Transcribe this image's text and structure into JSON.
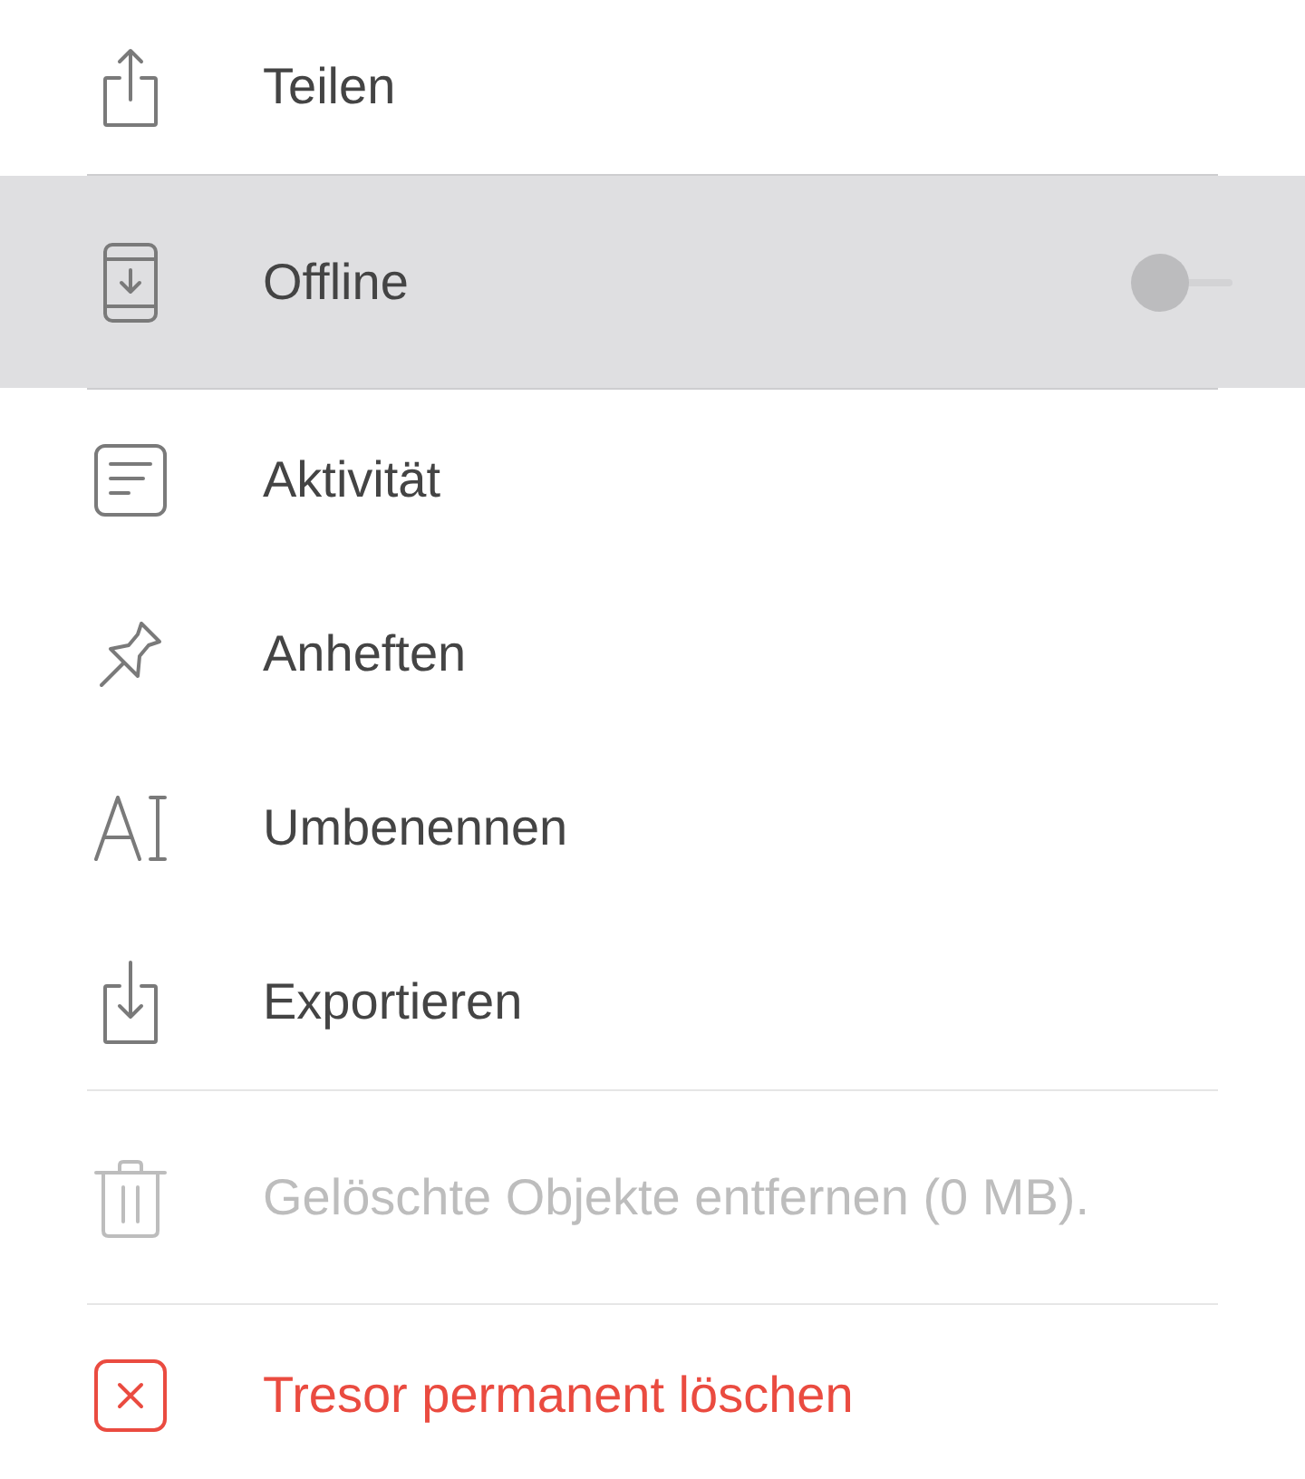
{
  "menu": {
    "groups": [
      {
        "items": [
          {
            "kind": "action",
            "label": "Teilen",
            "selected": false,
            "disabled": false
          }
        ]
      },
      {
        "items": [
          {
            "kind": "toggle",
            "label": "Offline",
            "selected": true,
            "disabled": false,
            "on": false
          }
        ]
      },
      {
        "items": [
          {
            "kind": "action",
            "label": "Aktivität",
            "selected": false,
            "disabled": false
          },
          {
            "kind": "action",
            "label": "Anheften",
            "selected": false,
            "disabled": false
          },
          {
            "kind": "action",
            "label": "Umbenennen",
            "selected": false,
            "disabled": false
          },
          {
            "kind": "action",
            "label": "Exportieren",
            "selected": false,
            "disabled": false
          }
        ]
      },
      {
        "items": [
          {
            "kind": "action",
            "label": "Gelöschte Objekte entfernen (0 MB).",
            "selected": false,
            "disabled": true
          }
        ]
      },
      {
        "items": [
          {
            "kind": "danger",
            "label": "Tresor permanent löschen",
            "selected": false,
            "disabled": false
          }
        ]
      }
    ]
  }
}
